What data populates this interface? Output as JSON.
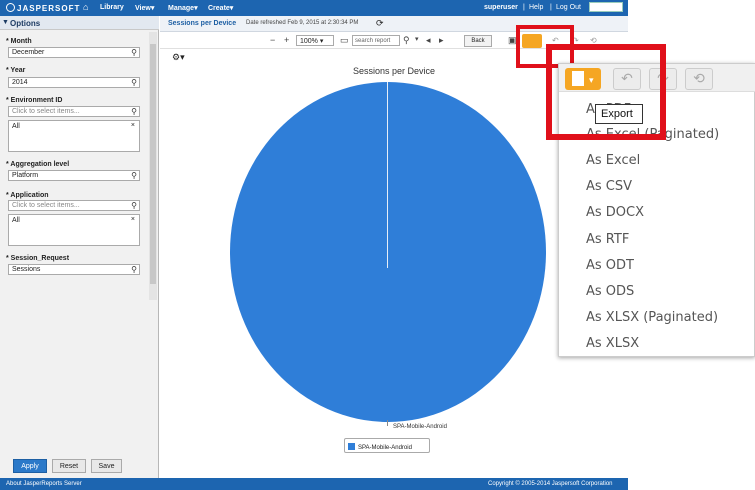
{
  "topbar": {
    "logo": "JASPERSOFT",
    "nav": [
      "Library",
      "View",
      "Manage",
      "Create"
    ],
    "user": "superuser",
    "help": "Help",
    "logout": "Log Out"
  },
  "options": {
    "title": "Options",
    "fields": [
      {
        "label": "* Month",
        "value": "December"
      },
      {
        "label": "* Year",
        "value": "2014"
      },
      {
        "label": "* Environment ID",
        "placeholder": "Click to select items...",
        "list": "All"
      },
      {
        "label": "* Aggregation level",
        "value": "Platform"
      },
      {
        "label": "* Application",
        "placeholder": "Click to select items...",
        "list": "All"
      },
      {
        "label": "* Session_Request",
        "value": "Sessions"
      }
    ],
    "buttons": {
      "apply": "Apply",
      "reset": "Reset",
      "save": "Save"
    }
  },
  "report": {
    "title": "Sessions per Device",
    "refreshed": "Date refreshed Feb 9, 2015 at 2:30:34 PM",
    "zoom": "100%",
    "search_placeholder": "search report",
    "back": "Back"
  },
  "chart_data": {
    "type": "pie",
    "title": "Sessions per Device",
    "categories": [
      "SPA-Mobile-Android"
    ],
    "values": [
      100
    ],
    "data_labels": [
      "SPA-Mobile-Android"
    ],
    "legend": [
      "SPA-Mobile-Android"
    ],
    "colors": [
      "#2f7ed8"
    ]
  },
  "export_menu": {
    "tooltip": "Export",
    "items": [
      "As PDF",
      "As Excel (Paginated)",
      "As Excel",
      "As CSV",
      "As DOCX",
      "As RTF",
      "As ODT",
      "As ODS",
      "As XLSX (Paginated)",
      "As XLSX"
    ]
  },
  "footer": {
    "left": "About JasperReports Server",
    "right": "Copyright © 2005-2014 Jaspersoft Corporation"
  }
}
